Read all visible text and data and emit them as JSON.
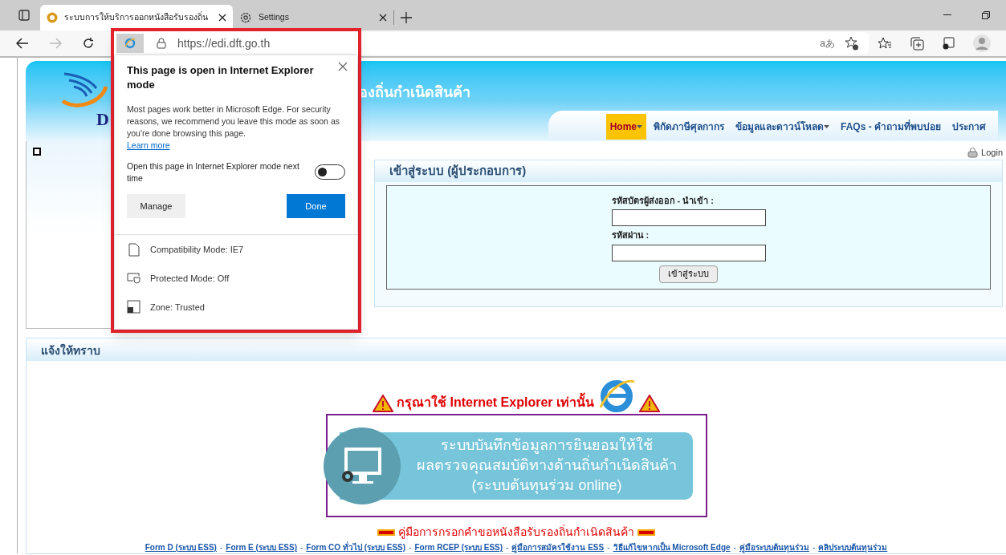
{
  "browser": {
    "tabs": [
      {
        "title": "ระบบการให้บริการออกหนังสือรับรองถิ่น",
        "kind": "site",
        "selected": true
      },
      {
        "title": "Settings",
        "kind": "settings",
        "selected": false
      }
    ],
    "address": "https://edi.dft.go.th",
    "read_aloud": "aあ"
  },
  "ie_popup": {
    "title": "This page is open in Internet Explorer mode",
    "body": "Most pages work better in Microsoft Edge. For security reasons, we recommend you leave this mode as soon as you're done browsing this page.",
    "learn_more": "Learn more",
    "toggle_label": "Open this page in Internet Explorer mode next time",
    "toggle_on": false,
    "buttons": [
      {
        "label": "Manage",
        "kind": "secondary"
      },
      {
        "label": "Done",
        "kind": "primary"
      }
    ],
    "info": [
      {
        "kind": "page",
        "text": "Compatibility Mode: IE7"
      },
      {
        "kind": "shield",
        "text": "Protected Mode: Off"
      },
      {
        "kind": "zone",
        "text": "Zone: Trusted"
      }
    ]
  },
  "site": {
    "logo_letter": "D",
    "title": "องถิ่นกำเนิดสินค้า",
    "nav": [
      {
        "label": "Home",
        "selected": true,
        "dropdown": true
      },
      {
        "label": "พิกัดภาษีศุลกากร",
        "selected": false,
        "dropdown": false
      },
      {
        "label": "ข้อมูลและดาวน์โหลด",
        "selected": false,
        "dropdown": true
      },
      {
        "label": "FAQs - คำถามที่พบบ่อย",
        "selected": false,
        "dropdown": false
      },
      {
        "label": "ประกาศ",
        "selected": false,
        "dropdown": false
      }
    ],
    "login_link": "Login",
    "login_panel": {
      "title": "เข้าสู่ระบบ (ผู้ประกอบการ)",
      "fields": [
        {
          "label": "รหัสบัตรผู้ส่งออก - นำเข้า :"
        },
        {
          "label": "รหัสผ่าน :"
        }
      ],
      "submit": "เข้าสู่ระบบ"
    },
    "notice": {
      "title": "แจ้งให้ทราบ",
      "warning": "กรุณาใช้ Internet Explorer เท่านั้น",
      "banner_lines": [
        "ระบบบันทึกข้อมูลการยินยอมให้ใช้",
        "ผลตรวจคุณสมบัติทางด้านถิ่นกำเนิดสินค้า",
        "(ระบบต้นทุนร่วม online)"
      ],
      "separator": "-",
      "manual": "คู่มือการกรอกคำขอหนังสือรับรองถิ่นกำเนิดสินค้า",
      "links": [
        "Form D (ระบบ ESS)",
        "Form E (ระบบ ESS)",
        "Form CO ทั่วไป (ระบบ ESS)",
        "Form RCEP (ระบบ ESS)",
        "คู่มือการสมัครใช้งาน ESS",
        "วิธีแก้ไขหากเป็น Microsoft Edge",
        "คู่มือระบบต้นทุนร่วม",
        "คลิประบบต้นทุนร่วม"
      ]
    }
  }
}
